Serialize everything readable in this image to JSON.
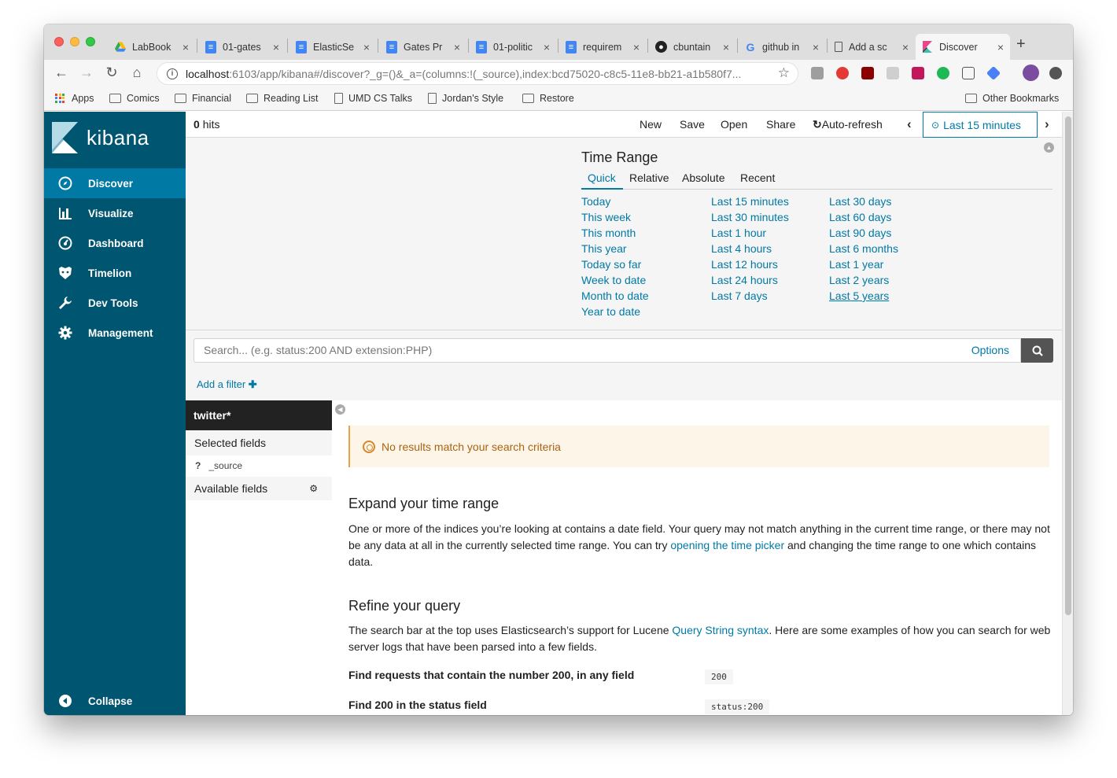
{
  "browser": {
    "tabs": [
      {
        "title": "LabBook",
        "icon": "google-drive-icon"
      },
      {
        "title": "01-gates",
        "icon": "google-docs-icon"
      },
      {
        "title": "ElasticSe",
        "icon": "google-docs-icon"
      },
      {
        "title": "Gates Pr",
        "icon": "google-docs-icon"
      },
      {
        "title": "01-politic",
        "icon": "google-docs-icon"
      },
      {
        "title": "requirem",
        "icon": "google-docs-icon"
      },
      {
        "title": "cbuntain",
        "icon": "github-icon"
      },
      {
        "title": "github in",
        "icon": "google-icon"
      },
      {
        "title": "Add a sc",
        "icon": "page-icon"
      },
      {
        "title": "Discover",
        "icon": "kibana-icon",
        "active": true
      }
    ],
    "url_host": "localhost",
    "url_rest": ":6103/app/kibana#/discover?_g=()&_a=(columns:!(_source),index:bcd75020-c8c5-11e8-bb21-a1b580f7...",
    "bookmarks": [
      "Apps",
      "Comics",
      "Financial",
      "Reading List",
      "UMD CS Talks",
      "Jordan's Style",
      "Restore"
    ],
    "other_bookmarks": "Other Bookmarks"
  },
  "kibana": {
    "logo_text": "kibana",
    "nav": [
      "Discover",
      "Visualize",
      "Dashboard",
      "Timelion",
      "Dev Tools",
      "Management"
    ],
    "collapse": "Collapse",
    "hits_count": "0",
    "hits_label": "hits",
    "top_menu": [
      "New",
      "Save",
      "Open",
      "Share",
      "Auto-refresh"
    ],
    "time_pill": "Last 15 minutes",
    "time_range": {
      "title": "Time Range",
      "tabs": [
        "Quick",
        "Relative",
        "Absolute",
        "Recent"
      ],
      "col1": [
        "Today",
        "This week",
        "This month",
        "This year",
        "Today so far",
        "Week to date",
        "Month to date",
        "Year to date"
      ],
      "col2": [
        "Last 15 minutes",
        "Last 30 minutes",
        "Last 1 hour",
        "Last 4 hours",
        "Last 12 hours",
        "Last 24 hours",
        "Last 7 days"
      ],
      "col3": [
        "Last 30 days",
        "Last 60 days",
        "Last 90 days",
        "Last 6 months",
        "Last 1 year",
        "Last 2 years",
        "Last 5 years"
      ]
    },
    "search_placeholder": "Search... (e.g. status:200 AND extension:PHP)",
    "search_options": "Options",
    "add_filter": "Add a filter",
    "index_pattern": "twitter*",
    "selected_fields": "Selected fields",
    "source_field_type": "?",
    "source_field": "_source",
    "available_fields": "Available fields",
    "no_results": "No results match your search criteria",
    "expand_title": "Expand your time range",
    "expand_text_1": "One or more of the indices you’re looking at contains a date field. Your query may not match anything in the current time range, or there may not be any data at all in the currently selected time range. You can try ",
    "expand_link": "opening the time picker",
    "expand_text_2": " and changing the time range to one which contains data.",
    "refine_title": "Refine your query",
    "refine_text_1": "The search bar at the top uses Elasticsearch’s support for Lucene ",
    "refine_link": "Query String syntax",
    "refine_text_2": ". Here are some examples of how you can search for web server logs that have been parsed into a few fields.",
    "examples": [
      {
        "label": "Find requests that contain the number 200, in any field",
        "code": "200"
      },
      {
        "label": "Find 200 in the status field",
        "code": "status:200"
      }
    ]
  }
}
